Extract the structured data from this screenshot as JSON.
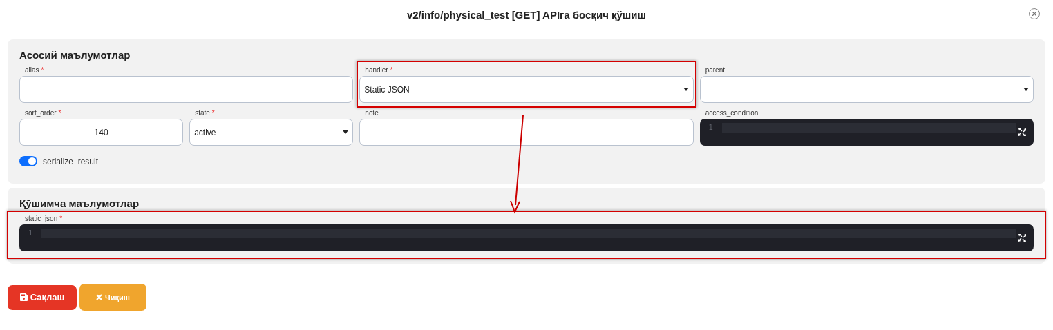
{
  "title": "v2/info/physical_test [GET] APIга босқич қўшиш",
  "sections": [
    {
      "heading": "Асосий маълумотлар",
      "fields": [
        {
          "kind": "input",
          "label": "alias",
          "marker": "*",
          "highlighted": false
        },
        {
          "kind": "select",
          "label": "handler",
          "marker": "*",
          "value": "Static JSON",
          "highlighted": true
        },
        {
          "kind": "select",
          "label": "parent",
          "highlighted": false
        },
        {
          "kind": "pair",
          "fields": [
            {
              "kind": "number",
              "label": "sort_order",
              "marker": "*",
              "value": "140",
              "highlighted": false
            },
            {
              "kind": "select",
              "label": "state",
              "marker": "*",
              "value": "active",
              "highlighted": false
            }
          ]
        },
        {
          "kind": "input",
          "label": "note",
          "highlighted": false
        },
        {
          "kind": "code",
          "label": "access_condition",
          "line": "1",
          "highlighted": false
        }
      ],
      "toggle": {
        "label": "serialize_result",
        "on": true
      }
    },
    {
      "heading": "Қўшимча маълумотлар",
      "fields": [
        {
          "kind": "code",
          "label": "static_json",
          "marker": "*",
          "line": "1",
          "highlighted": true
        }
      ]
    }
  ],
  "annotation_arrow": true,
  "buttons": [
    {
      "kind": "save",
      "label": "Сақлаш"
    },
    {
      "kind": "exit",
      "label": "Чиқиш"
    }
  ]
}
